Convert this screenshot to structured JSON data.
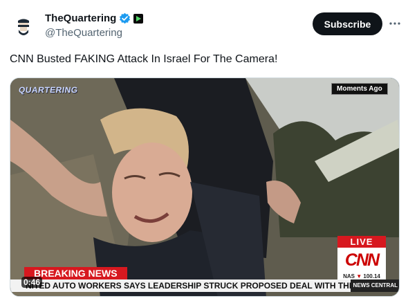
{
  "account": {
    "name": "TheQuartering",
    "handle": "@TheQuartering"
  },
  "actions": {
    "subscribe_label": "Subscribe",
    "more_icon": "more-horizontal-icon"
  },
  "tweet": {
    "text": "CNN Busted FAKING Attack In Israel For The Camera!"
  },
  "video": {
    "watermark": "QUARTERING",
    "moments_badge": "Moments Ago",
    "live_label": "LIVE",
    "network_logo": "CNN",
    "market_prefix": "NAS",
    "market_arrow": "▼",
    "market_value": "100.14",
    "breaking_label": "BREAKING NEWS",
    "crawl_text": "NITED AUTO WORKERS SAYS LEADERSHIP STRUCK PROPOSED DEAL WITH THE HEAVY-DU",
    "news_central": "NEWS CENTRAL",
    "timestamp": "0:46"
  },
  "colors": {
    "cnn_red": "#cc0000",
    "breaking_red": "#d7181f",
    "verified_blue": "#1d9bf0",
    "text_dark": "#0f1419",
    "text_muted": "#536471"
  }
}
